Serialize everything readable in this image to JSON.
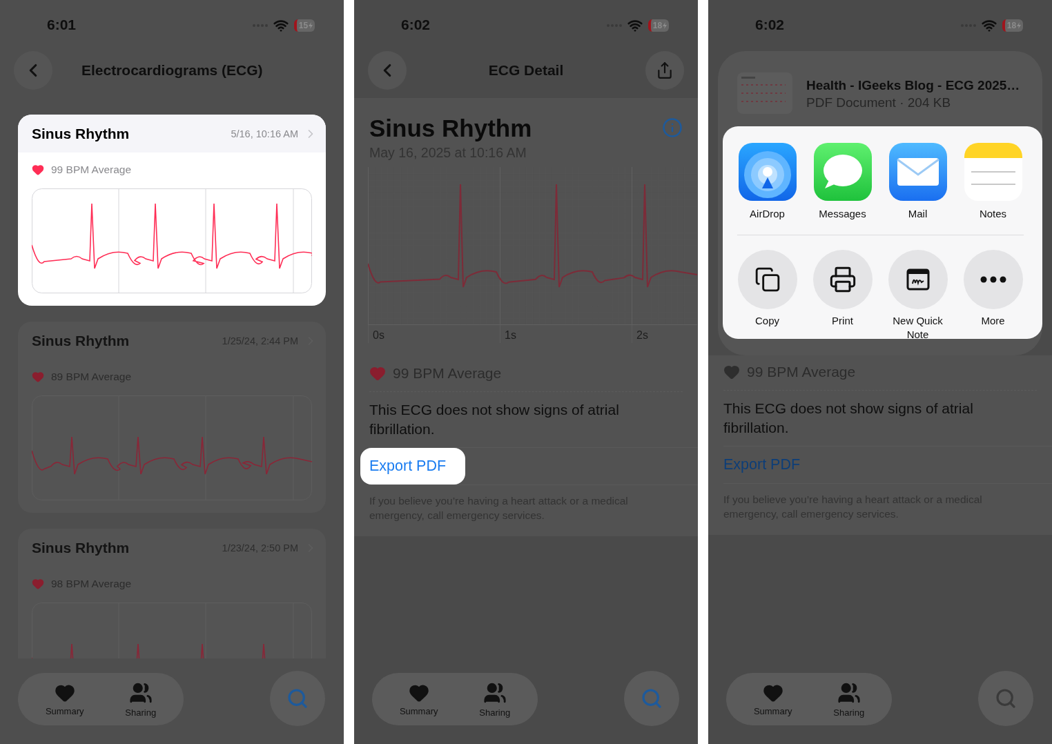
{
  "screens": [
    {
      "kind": "list",
      "status_bar": {
        "time": "6:01",
        "battery": "15"
      },
      "title": "Electrocardiograms (ECG)",
      "recordings": [
        {
          "title": "Sinus Rhythm",
          "date": "5/16, 10:16 AM",
          "average": "99 BPM Average",
          "selected": true
        },
        {
          "title": "Sinus Rhythm",
          "date": "1/25/24, 2:44 PM",
          "average": "89 BPM Average",
          "selected": false
        },
        {
          "title": "Sinus Rhythm",
          "date": "1/23/24, 2:50 PM",
          "average": "98 BPM Average",
          "selected": false
        }
      ],
      "tab_bar": [
        "Summary",
        "Sharing"
      ]
    },
    {
      "kind": "detail",
      "status_bar": {
        "time": "6:02",
        "battery": "18"
      },
      "title": "ECG Detail",
      "classification": "Sinus Rhythm",
      "recorded": "May 16, 2025 at 10:16 AM",
      "time_labels": [
        "0s",
        "1s",
        "2s"
      ],
      "average": "99 BPM Average",
      "finding": "This ECG does not show signs of atrial fibrillation.",
      "export": {
        "label": "Export PDF",
        "selected": true
      },
      "disclaimer": "If you believe you’re having a heart attack or a medical emergency, call emergency services.",
      "tab_bar": [
        "Summary",
        "Sharing"
      ]
    },
    {
      "kind": "share",
      "status_bar": {
        "time": "6:02",
        "battery": "18"
      },
      "file": {
        "name": "Health - IGeeks Blog - ECG 2025…",
        "info": "PDF Document · 204 KB"
      },
      "apps": [
        {
          "kind": "airdrop",
          "label": "AirDrop"
        },
        {
          "kind": "messages",
          "label": "Messages"
        },
        {
          "kind": "mail",
          "label": "Mail"
        },
        {
          "kind": "notes",
          "label": "Notes"
        }
      ],
      "actions": [
        {
          "kind": "copy",
          "label": "Copy"
        },
        {
          "kind": "print",
          "label": "Print"
        },
        {
          "kind": "quick_note",
          "label": "New Quick Note"
        },
        {
          "kind": "more",
          "label": "More"
        }
      ],
      "average": "99 BPM Average",
      "finding": "This ECG does not show signs of atrial fibrillation.",
      "export": {
        "label": "Export PDF",
        "selected": false
      },
      "disclaimer": "If you believe you’re having a heart attack or a medical emergency, call emergency services.",
      "tab_bar": [
        "Summary",
        "Sharing"
      ]
    }
  ]
}
